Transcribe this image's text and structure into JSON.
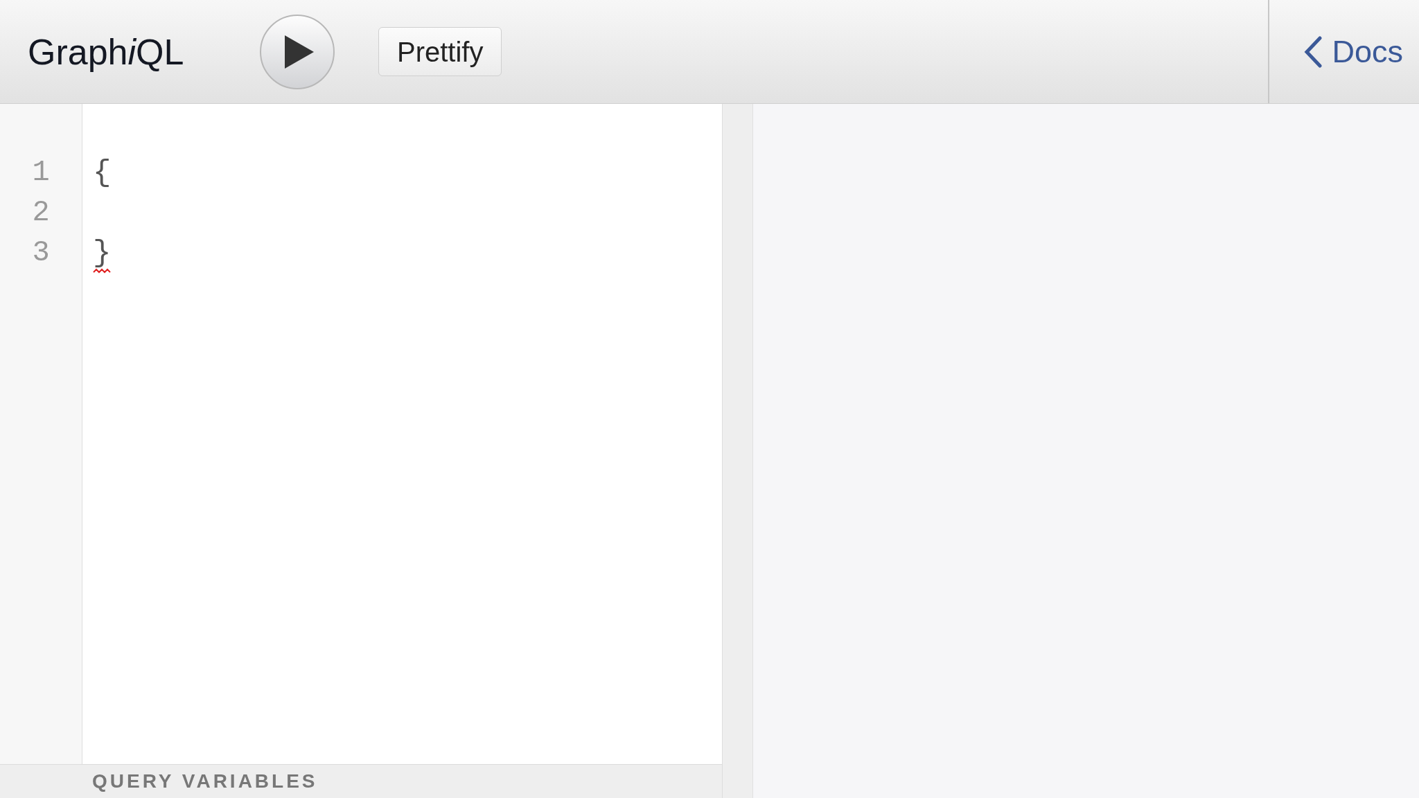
{
  "header": {
    "title_parts": [
      {
        "text": "Graph",
        "italic": false
      },
      {
        "text": "i",
        "italic": true
      },
      {
        "text": "QL",
        "italic": false
      }
    ],
    "prettify": "Prettify",
    "docs": "Docs"
  },
  "editor": {
    "lines": [
      {
        "number": "1",
        "text": "{",
        "error": false
      },
      {
        "number": "2",
        "error": false
      },
      {
        "number": "3",
        "text": "}",
        "error": true
      }
    ]
  },
  "variables": {
    "title": "QUERY VARIABLES"
  }
}
